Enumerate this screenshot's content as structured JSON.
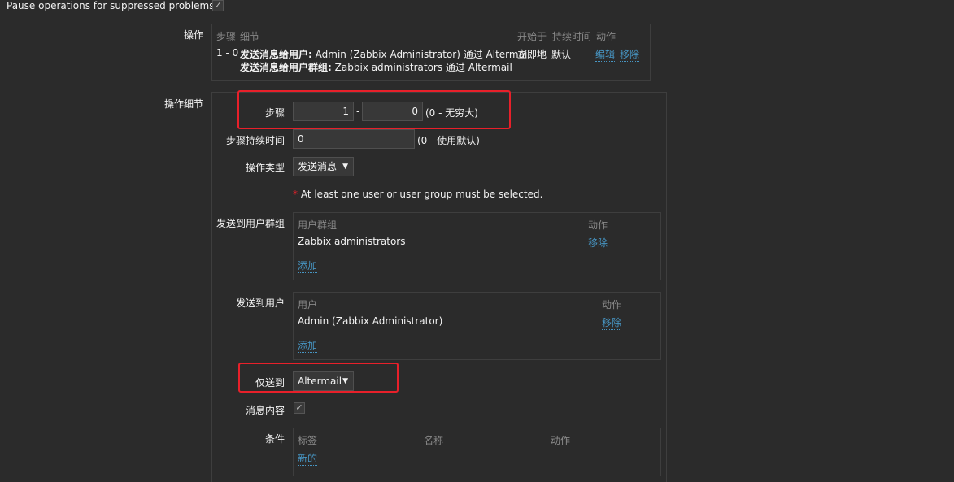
{
  "top": {
    "pause_label": "Pause operations for suppressed problems",
    "pause_checked": true
  },
  "operations": {
    "label": "操作",
    "headers": {
      "steps": "步骤",
      "details": "细节",
      "start_in": "开始于",
      "duration": "持续时间",
      "action": "动作"
    },
    "row": {
      "steps": "1 - 0",
      "line1_bold": "发送消息给用户:",
      "line1_text": "Admin (Zabbix Administrator) 通过 Altermail",
      "line2_bold": "发送消息给用户群组:",
      "line2_text": "Zabbix administrators 通过 Altermail",
      "start_in": "立即地",
      "duration": "默认",
      "edit": "编辑",
      "remove": "移除"
    }
  },
  "details": {
    "label": "操作细节",
    "steps_label": "步骤",
    "step_from": "1",
    "step_dash": "-",
    "step_to": "0",
    "step_hint": "(0 - 无穷大)",
    "duration_label": "步骤持续时间",
    "duration_value": "0",
    "duration_hint": "(0 - 使用默认)",
    "optype_label": "操作类型",
    "optype_value": "发送消息",
    "warning_star": "*",
    "warning_text": "At least one user or user group must be selected.",
    "usergroups": {
      "label": "发送到用户群组",
      "col_name": "用户群组",
      "col_action": "动作",
      "row_name": "Zabbix administrators",
      "remove": "移除",
      "add": "添加"
    },
    "users": {
      "label": "发送到用户",
      "col_name": "用户",
      "col_action": "动作",
      "row_name": "Admin (Zabbix Administrator)",
      "remove": "移除",
      "add": "添加"
    },
    "sendonly_label": "仅送到",
    "sendonly_value": "Altermail",
    "msgcontent_label": "消息内容",
    "msgcontent_checked": true,
    "conditions": {
      "label": "条件",
      "col_tag": "标签",
      "col_name": "名称",
      "col_action": "动作",
      "new": "新的"
    }
  },
  "colors": {
    "background": "#2b2b2b",
    "link": "#4796c4",
    "highlight": "#e8202a"
  },
  "icons": {
    "checkbox": "check-icon",
    "dropdown": "triangle-down-icon"
  }
}
